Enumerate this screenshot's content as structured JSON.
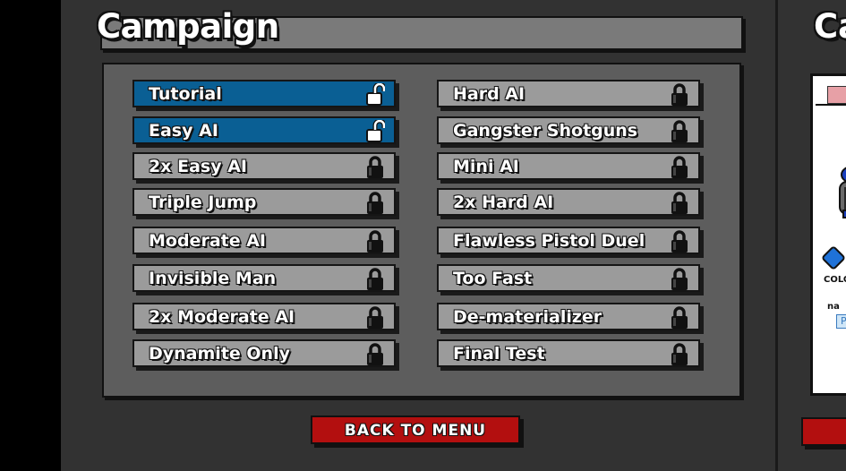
{
  "title": "Campaign",
  "levels_left": [
    {
      "label": "Tutorial",
      "status": "unlocked"
    },
    {
      "label": "Easy AI",
      "status": "unlocked"
    },
    {
      "label": "2x Easy AI",
      "status": "locked"
    },
    {
      "label": "Triple Jump",
      "status": "locked"
    },
    {
      "label": "Moderate AI",
      "status": "locked"
    },
    {
      "label": "Invisible Man",
      "status": "locked"
    },
    {
      "label": "2x Moderate AI",
      "status": "locked"
    },
    {
      "label": "Dynamite Only",
      "status": "locked"
    }
  ],
  "levels_right": [
    {
      "label": "Hard AI",
      "status": "locked"
    },
    {
      "label": "Gangster Shotguns",
      "status": "locked"
    },
    {
      "label": "Mini AI",
      "status": "locked"
    },
    {
      "label": "2x Hard AI",
      "status": "locked"
    },
    {
      "label": "Flawless Pistol Duel",
      "status": "locked"
    },
    {
      "label": "Too Fast",
      "status": "locked"
    },
    {
      "label": "De-materializer",
      "status": "locked"
    },
    {
      "label": "Final Test",
      "status": "locked"
    }
  ],
  "back_button": "BACK TO MENU",
  "side_panel": {
    "title_fragment": "Ca",
    "text1": "COLO",
    "text2": "na",
    "input_value": "P"
  },
  "colors": {
    "unlocked": "#0a5f94",
    "locked": "#9b9b9b",
    "back_button": "#b30f0f",
    "panel": "#323232"
  }
}
